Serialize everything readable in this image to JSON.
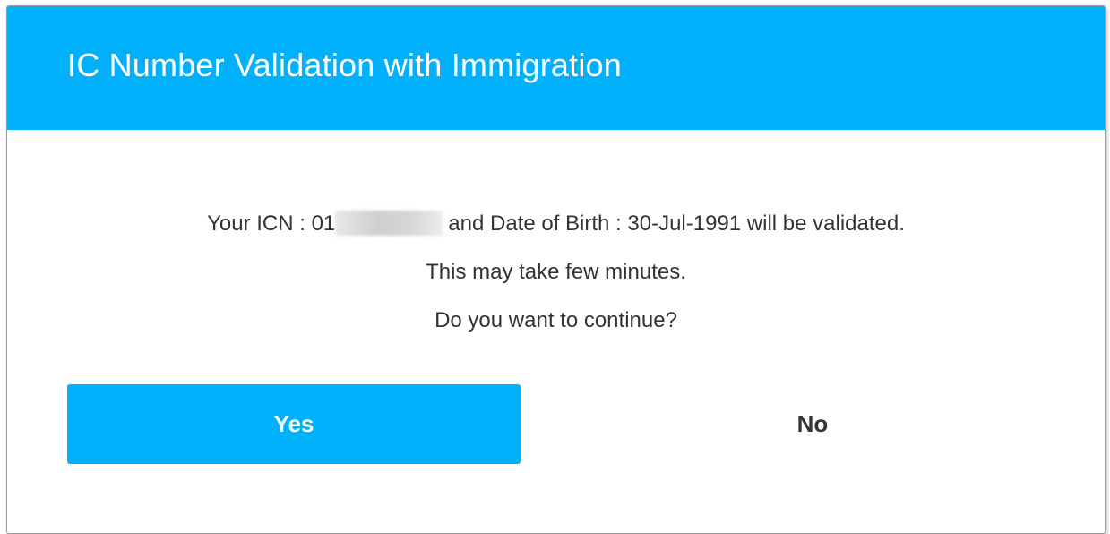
{
  "dialog": {
    "title": "IC Number Validation with Immigration",
    "header_color": "#00b0fb",
    "message": {
      "line1_prefix": "Your ICN : 01",
      "line1_suffix": "and Date of Birth : 30-Jul-1991 will be validated.",
      "line2": "This may take few minutes.",
      "line3": "Do you want to continue?"
    },
    "buttons": {
      "yes_label": "Yes",
      "no_label": "No",
      "yes_color": "#00b0fb"
    }
  }
}
